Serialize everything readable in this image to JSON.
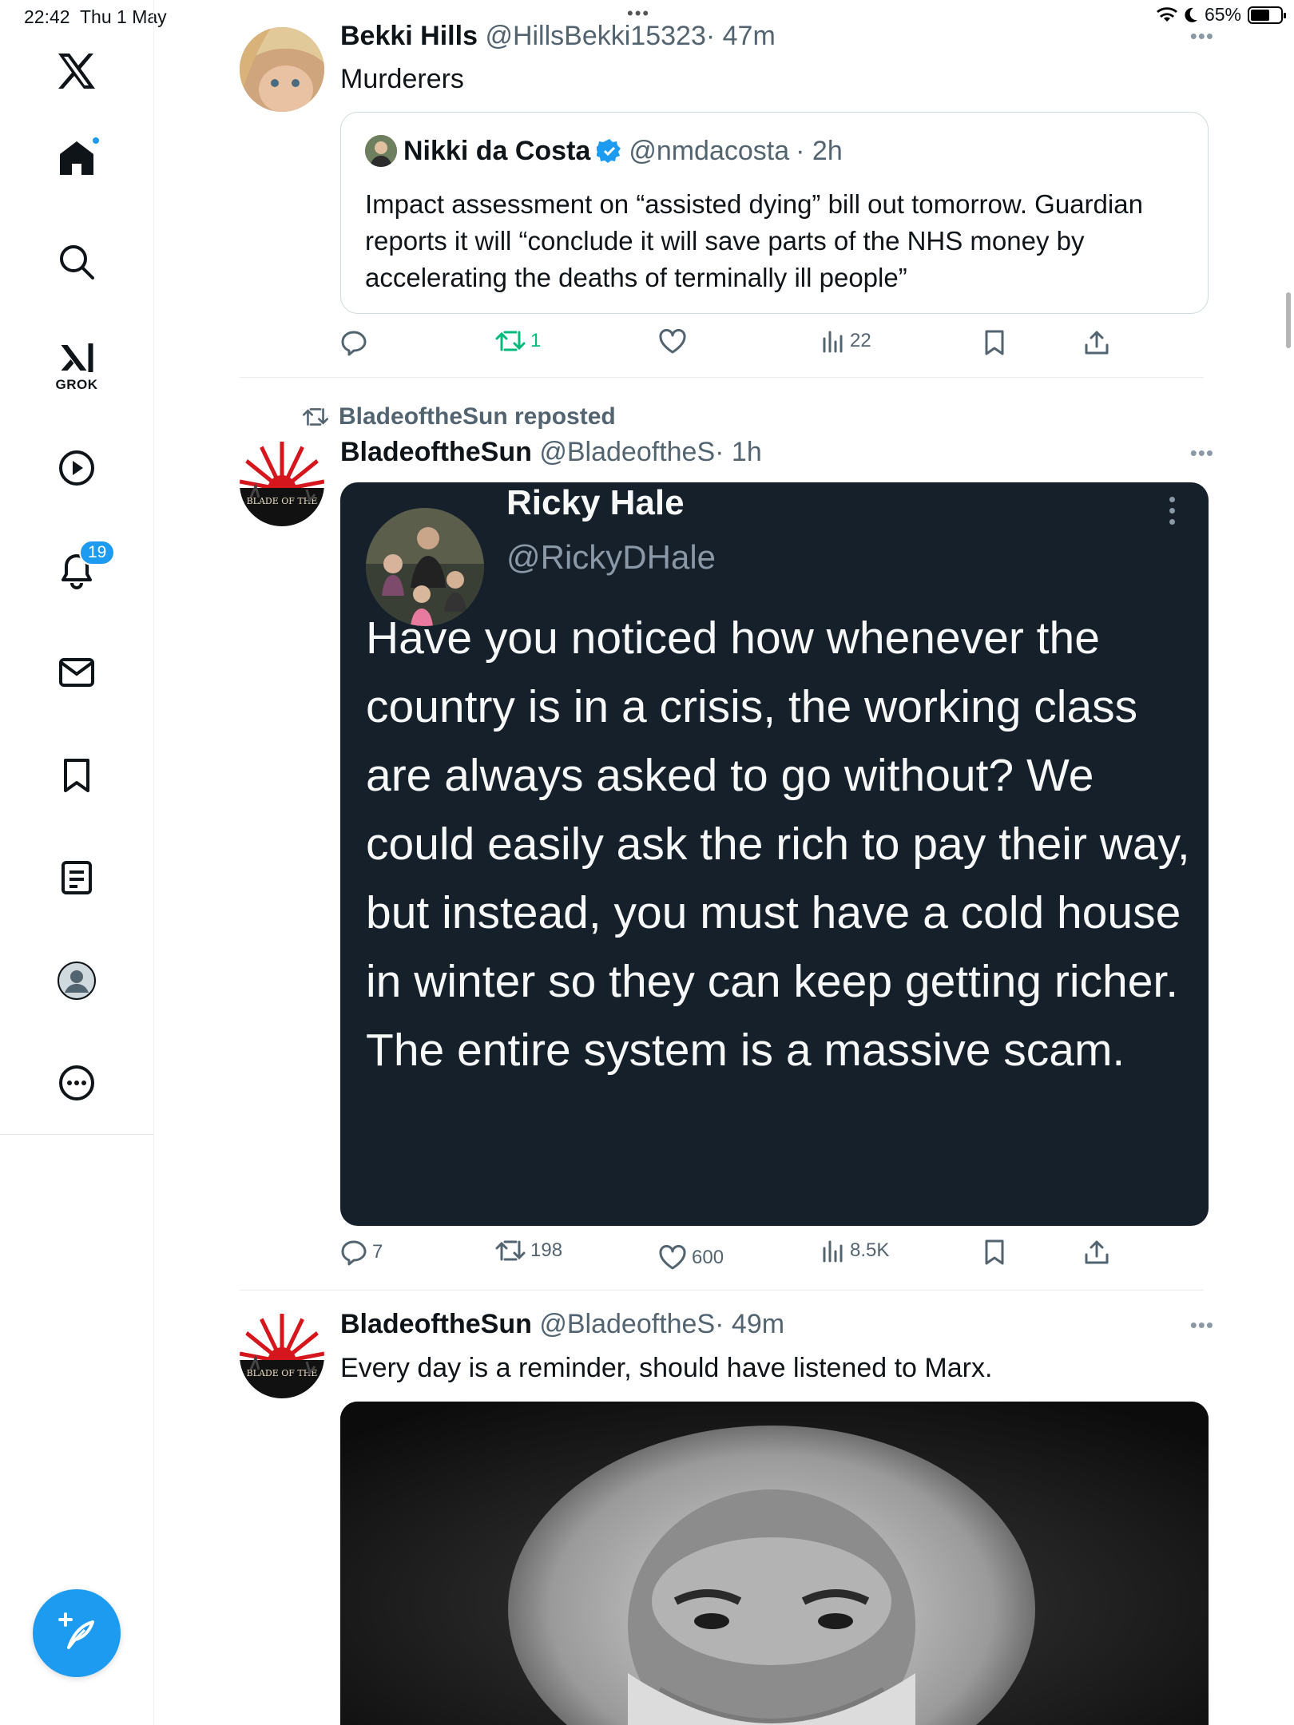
{
  "status": {
    "time": "22:42",
    "date": "Thu 1 May",
    "battery": "65%",
    "battery_level": 0.65,
    "icons": [
      "wifi-icon",
      "moon-icon",
      "battery-icon"
    ]
  },
  "sidebar": {
    "logo": "X",
    "grok_label": "GROK",
    "notifications_badge": "19",
    "items": [
      "home-icon",
      "search-icon",
      "grok-icon",
      "video-icon",
      "notifications-icon",
      "messages-icon",
      "bookmarks-icon",
      "lists-icon",
      "profile-icon",
      "more-icon"
    ],
    "compose_icon": "compose-icon"
  },
  "tweets": [
    {
      "name": "Bekki Hills",
      "handle": "@HillsBekki15323",
      "time": "· 47m",
      "text": "Murderers",
      "quote": {
        "name": "Nikki da Costa",
        "handle": "@nmdacosta",
        "time": "· 2h",
        "text": "Impact assessment on “assisted dying” bill out tomorrow. Guardian reports it will “conclude it will save parts of the NHS money by accelerating the deaths of terminally ill people”"
      },
      "actions": {
        "replies": "",
        "reposts": "1",
        "likes": "",
        "views": "22"
      }
    },
    {
      "repost_label": "BladeoftheSun reposted",
      "name": "BladeoftheSun",
      "handle": "@BladeoftheS",
      "time": "· 1h",
      "card": {
        "name": "Ricky Hale",
        "handle": "@RickyDHale",
        "text": "Have you noticed how whenever the country is in a crisis, the working class are always asked to go without? We could easily ask the rich to pay their way, but instead, you must have a cold house in winter so they can keep getting richer. The entire system is a massive scam."
      },
      "actions": {
        "replies": "7",
        "reposts": "198",
        "likes": "600",
        "views": "8.5K"
      }
    },
    {
      "name": "BladeoftheSun",
      "handle": "@BladeoftheS",
      "time": "· 49m",
      "text": "Every day is a reminder, should have listened to Marx."
    }
  ],
  "avatar_logo_text": "BLADE OF THE",
  "colors": {
    "accent": "#1d9bf0",
    "repost_green": "#00ba7c",
    "muted": "#536471",
    "dark_card": "#15202b"
  }
}
